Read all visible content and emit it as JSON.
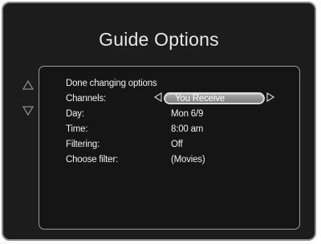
{
  "screen": {
    "title": "Guide Options",
    "accent_bg": "#1c1c1c",
    "panel_border": "#9a9a9a"
  },
  "nav": {
    "up_icon": "up-triangle-outline",
    "down_icon": "down-triangle-outline"
  },
  "menu": {
    "done_label": "Done changing options",
    "rows": [
      {
        "label": "Channels:",
        "value": "You Receive",
        "selected": true
      },
      {
        "label": "Day:",
        "value": "Mon 6/9"
      },
      {
        "label": "Time:",
        "value": "8:00 am"
      },
      {
        "label": "Filtering:",
        "value": "Off"
      },
      {
        "label": "Choose filter:",
        "value": "(Movies)"
      }
    ]
  }
}
